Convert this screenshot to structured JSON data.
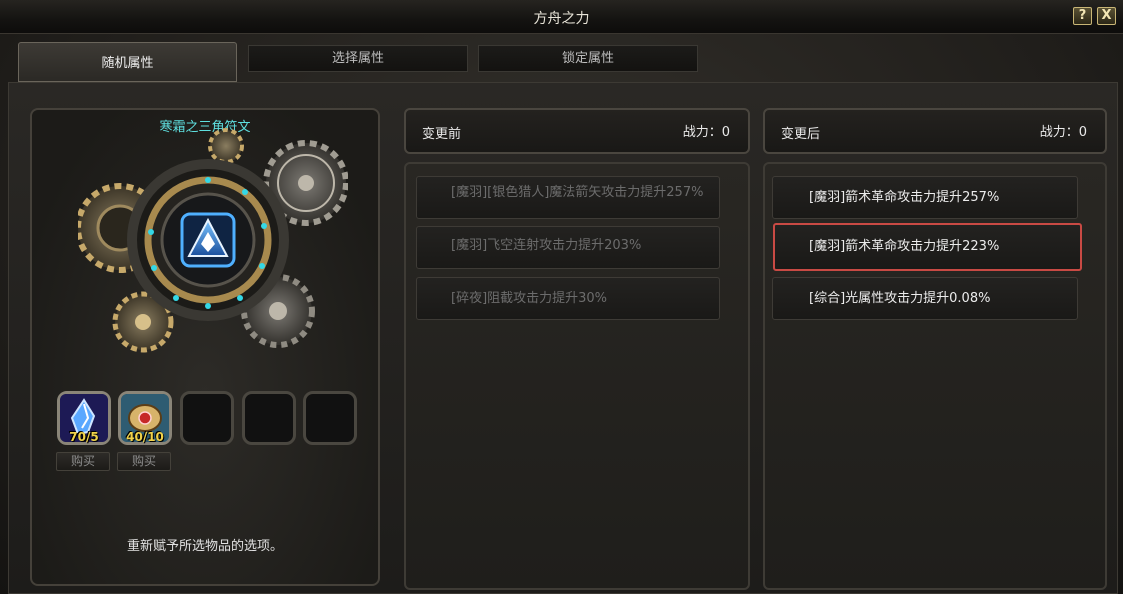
{
  "window": {
    "title": "方舟之力",
    "help_label": "?",
    "close_label": "X"
  },
  "tabs": [
    {
      "label": "随机属性",
      "active": true
    },
    {
      "label": "选择属性",
      "active": false
    },
    {
      "label": "锁定属性",
      "active": false
    }
  ],
  "left": {
    "item_name": "寒霜之三角符文",
    "slots": [
      {
        "count": "70/5",
        "icon": "blue-crystal-icon",
        "buy_label": "购买"
      },
      {
        "count": "40/10",
        "icon": "red-gem-scroll-icon",
        "buy_label": "购买"
      },
      {
        "count": "",
        "icon": "empty-slot"
      },
      {
        "count": "",
        "icon": "empty-slot"
      },
      {
        "count": "",
        "icon": "empty-slot"
      }
    ],
    "hint": "重新赋予所选物品的选项。"
  },
  "before": {
    "header": "变更前",
    "power": "战力：0",
    "options": [
      "[魔羽][银色猎人]魔法箭矢攻击力提升257%",
      "[魔羽]飞空连射攻击力提升203%",
      "[碎夜]阻截攻击力提升30%"
    ]
  },
  "after": {
    "header": "变更后",
    "power": "战力：0",
    "options": [
      "[魔羽]箭术革命攻击力提升257%",
      "[魔羽]箭术革命攻击力提升223%",
      "[综合]光属性攻击力提升0.08%"
    ],
    "highlight_color": "#c94a44"
  },
  "colors": {
    "accent_cyan": "#5fe0e0",
    "count_yellow": "#f0d24a"
  }
}
